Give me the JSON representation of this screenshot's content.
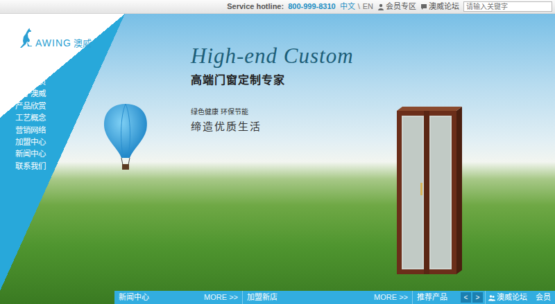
{
  "logo": {
    "brand": "AWING",
    "brand_cn": "澳威"
  },
  "topbar": {
    "hotline_label": "Service hotline:",
    "hotline": "800-999-8310",
    "languages": [
      {
        "label": "中文",
        "selected": true
      },
      {
        "label": "EN",
        "selected": false
      }
    ],
    "separator": "\\",
    "links": [
      {
        "label": "会员专区"
      },
      {
        "label": "澳威论坛"
      }
    ],
    "search": {
      "placeholder": "请输入关键字"
    }
  },
  "nav": {
    "items": [
      {
        "label": "澳威首页",
        "selected": false
      },
      {
        "label": "关于澳威",
        "selected": false
      },
      {
        "label": "产品欣赏",
        "selected": false
      },
      {
        "label": "工艺概念",
        "selected": false
      },
      {
        "label": "营销网络",
        "selected": false
      },
      {
        "label": "加盟中心",
        "selected": false
      },
      {
        "label": "新闻中心",
        "selected": false
      },
      {
        "label": "联系我们",
        "selected": false
      }
    ]
  },
  "banner": {
    "title_en": "High-end Custom",
    "title": "高端门窗定制专家",
    "tagline": "绿色健康 环保节能",
    "slogan": "缔造优质生活"
  },
  "bottom_bar": {
    "sections": [
      {
        "title": "新闻中心",
        "more": "MORE >>"
      },
      {
        "title": "加盟新店",
        "more": "MORE >>"
      },
      {
        "title": "推荐产品",
        "arrows": [
          "<",
          ">"
        ]
      }
    ],
    "links": [
      "澳威论坛",
      "会员"
    ]
  }
}
